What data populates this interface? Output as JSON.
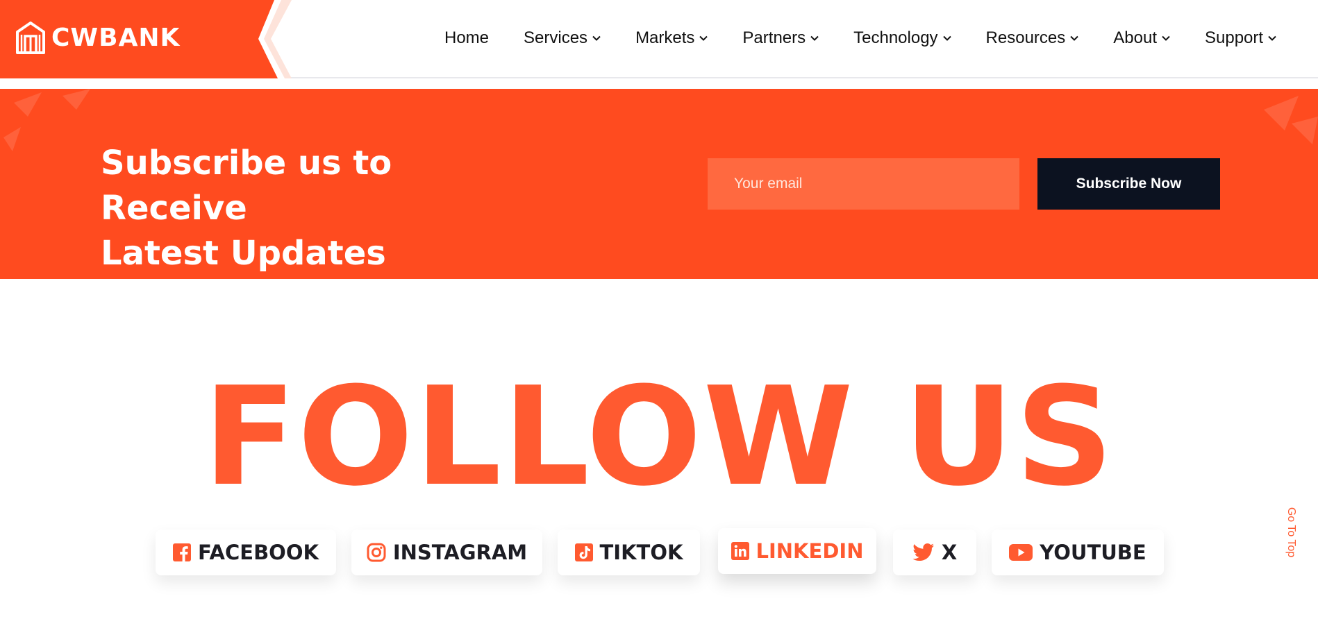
{
  "brand": {
    "name": "CWBANK",
    "accent": "#ff4b1f",
    "dark": "#0c1220"
  },
  "nav": {
    "items": [
      {
        "label": "Home",
        "dropdown": false
      },
      {
        "label": "Services",
        "dropdown": true
      },
      {
        "label": "Markets",
        "dropdown": true
      },
      {
        "label": "Partners",
        "dropdown": true
      },
      {
        "label": "Technology",
        "dropdown": true
      },
      {
        "label": "Resources",
        "dropdown": true
      },
      {
        "label": "About",
        "dropdown": true
      },
      {
        "label": "Support",
        "dropdown": true
      }
    ]
  },
  "subscribe": {
    "title_line1": "Subscribe us to Receive",
    "title_line2": "Latest Updates",
    "email_placeholder": "Your email",
    "button_label": "Subscribe Now"
  },
  "follow": {
    "heading": "FOLLOW US",
    "socials": [
      {
        "label": "FACEBOOK",
        "icon": "facebook-icon"
      },
      {
        "label": "INSTAGRAM",
        "icon": "instagram-icon"
      },
      {
        "label": "TIKTOK",
        "icon": "tiktok-icon"
      },
      {
        "label": "LINKEDIN",
        "icon": "linkedin-icon",
        "active": true
      },
      {
        "label": "X",
        "icon": "twitter-icon"
      },
      {
        "label": "YOUTUBE",
        "icon": "youtube-icon"
      }
    ]
  },
  "goto_top": "Go To Top"
}
